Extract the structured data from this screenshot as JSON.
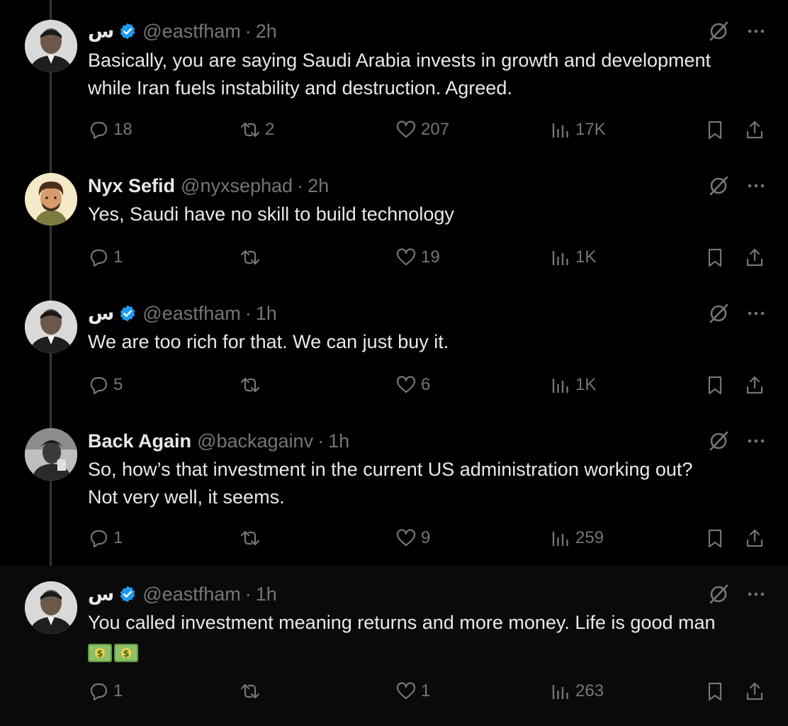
{
  "tweets": [
    {
      "display_name": "س",
      "verified": true,
      "handle": "@eastfham",
      "dot": "·",
      "time": "2h",
      "text_lines": [
        "Basically, you are saying Saudi Arabia invests in growth and development",
        "while Iran fuels instability and destruction. Agreed."
      ],
      "replies": "18",
      "retweets": "2",
      "likes": "207",
      "views": "17K"
    },
    {
      "display_name": "Nyx Sefid",
      "verified": false,
      "handle": "@nyxsephad",
      "dot": "·",
      "time": "2h",
      "text_lines": [
        "Yes, Saudi have no skill to build technology"
      ],
      "replies": "1",
      "retweets": "",
      "likes": "19",
      "views": "1K"
    },
    {
      "display_name": "س",
      "verified": true,
      "handle": "@eastfham",
      "dot": "·",
      "time": "1h",
      "text_lines": [
        "We are too rich for that. We can just buy it."
      ],
      "replies": "5",
      "retweets": "",
      "likes": "6",
      "views": "1K"
    },
    {
      "display_name": "Back Again",
      "verified": false,
      "handle": "@backagainv",
      "dot": "·",
      "time": "1h",
      "text_lines": [
        "So, how’s that investment in the current US administration working out?",
        "Not very well, it seems."
      ],
      "replies": "1",
      "retweets": "",
      "likes": "9",
      "views": "259"
    },
    {
      "display_name": "س",
      "verified": true,
      "handle": "@eastfham",
      "dot": "·",
      "time": "1h",
      "text_lines": [
        "You called investment meaning returns and more money. Life is good man"
      ],
      "emoji": [
        "dollar-banknote-emoji",
        "dollar-banknote-emoji"
      ],
      "replies": "1",
      "retweets": "",
      "likes": "1",
      "views": "263"
    }
  ],
  "colors": {
    "background": "#000000",
    "highlight_background": "#0a0a0a",
    "text": "#e7e9ea",
    "muted": "#71767b",
    "verified_blue": "#1d9bf0",
    "thread_line": "#333639"
  },
  "icons": [
    "reply-icon",
    "retweet-icon",
    "like-icon",
    "views-icon",
    "bookmark-icon",
    "share-icon",
    "grok-icon",
    "more-icon",
    "verified-badge-icon"
  ]
}
